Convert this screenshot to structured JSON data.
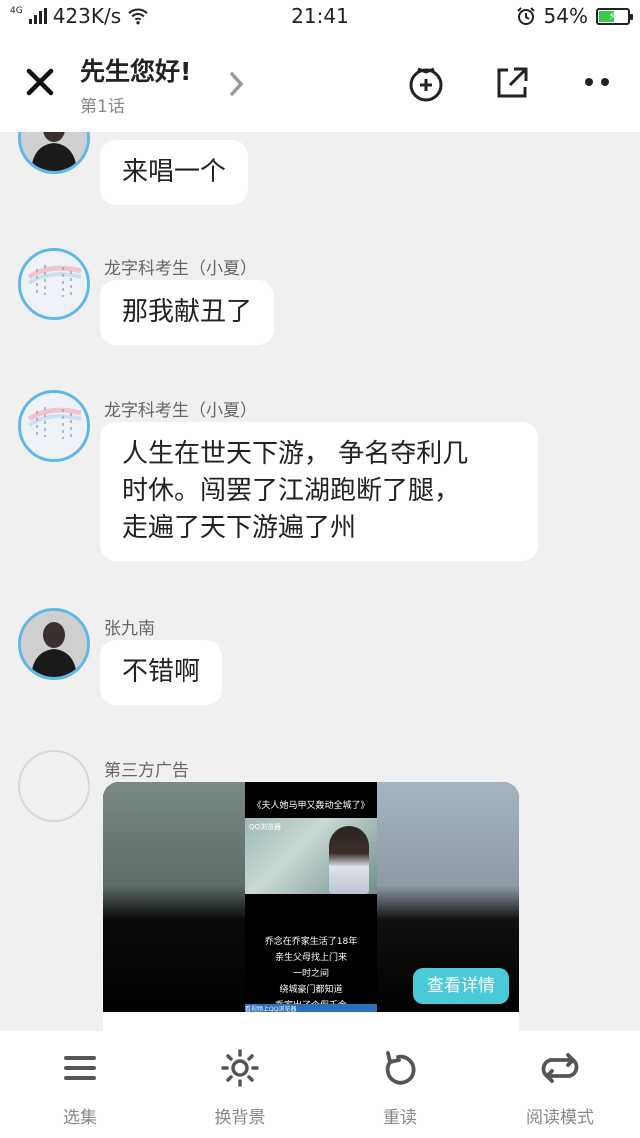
{
  "status_bar": {
    "network": "4G",
    "speed": "423K/s",
    "time": "21:41",
    "battery_percent": "54%",
    "battery_level": 0.54,
    "icons": [
      "signal-icon",
      "wifi-icon",
      "alarm-icon",
      "battery-icon"
    ]
  },
  "header": {
    "title": "先生您好!",
    "subtitle": "第1话",
    "icons": [
      "close-icon",
      "chevron-right-icon",
      "tomato-add-icon",
      "share-icon",
      "more-icon"
    ]
  },
  "messages": [
    {
      "sender": "",
      "text": "来唱一个"
    },
    {
      "sender": "龙字科考生（小夏）",
      "text": "那我献丑了"
    },
    {
      "sender": "龙字科考生（小夏）",
      "lines": [
        "人生在世天下游， 争名夺利几",
        "时休。闯罢了江湖跑断了腿，",
        "走遍了天下游遍了州"
      ]
    },
    {
      "sender": "张九南",
      "text": "不错啊"
    }
  ],
  "ad": {
    "sender": "第三方广告",
    "video_title": "《夫人她马甲又轰动全城了》",
    "video_logo": "QQ浏览器",
    "captions": [
      "乔念在乔家生活了18年",
      "亲生父母找上门来",
      "一时之间",
      "绕城豪门都知道",
      "乔家出了个假千金"
    ],
    "footer_text": "看视频上QQ浏览器",
    "button_label": "查看详情",
    "button_color": "#4ac9d6"
  },
  "bottom_nav": [
    {
      "label": "选集",
      "icon": "list-icon"
    },
    {
      "label": "换背景",
      "icon": "brightness-icon"
    },
    {
      "label": "重读",
      "icon": "replay-icon"
    },
    {
      "label": "阅读模式",
      "icon": "loop-icon"
    }
  ],
  "colors": {
    "avatar_border": "#5fb8e8",
    "background": "#f0f0f0",
    "battery_fill": "#3ac84a"
  }
}
